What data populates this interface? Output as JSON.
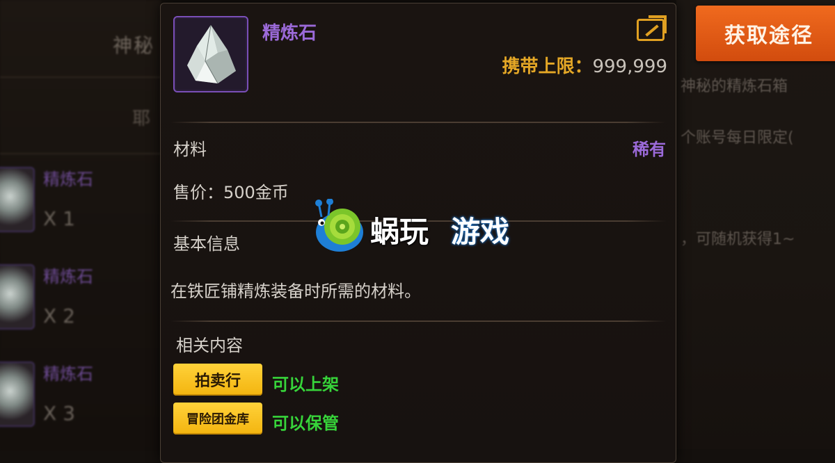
{
  "background": {
    "left_title": "神秘",
    "left_sub": "耶",
    "left_items": [
      {
        "name": "精炼石",
        "qty": "X 1"
      },
      {
        "name": "精炼石",
        "qty": "X 2"
      },
      {
        "name": "精炼石",
        "qty": "X 3"
      }
    ],
    "right_texts": [
      "神秘的精炼石箱",
      "个账号每日限定(",
      "，可随机获得1~"
    ]
  },
  "get_source_button": {
    "label": "获取途径"
  },
  "tooltip": {
    "item_name": "精炼石",
    "carry_limit_label": "携带上限：",
    "carry_limit_value": "999,999",
    "category": "材料",
    "rarity": "稀有",
    "sell_price": "售价：500金币",
    "basic_info_header": "基本信息",
    "description": "在铁匠铺精炼装备时所需的材料。",
    "related_header": "相关内容",
    "related": [
      {
        "button": "拍卖行",
        "note": "可以上架"
      },
      {
        "button": "冒险团金库",
        "note": "可以保管"
      }
    ]
  },
  "watermark": {
    "text1": "蜗玩",
    "text2": "游戏"
  },
  "colors": {
    "rarity_purple": "#9b6ad9",
    "limit_gold": "#e4a726",
    "note_green": "#37d43a",
    "button_orange": "#e45c14"
  },
  "icons": [
    "refine-stone-icon",
    "share-export-icon",
    "snail-logo-icon"
  ]
}
